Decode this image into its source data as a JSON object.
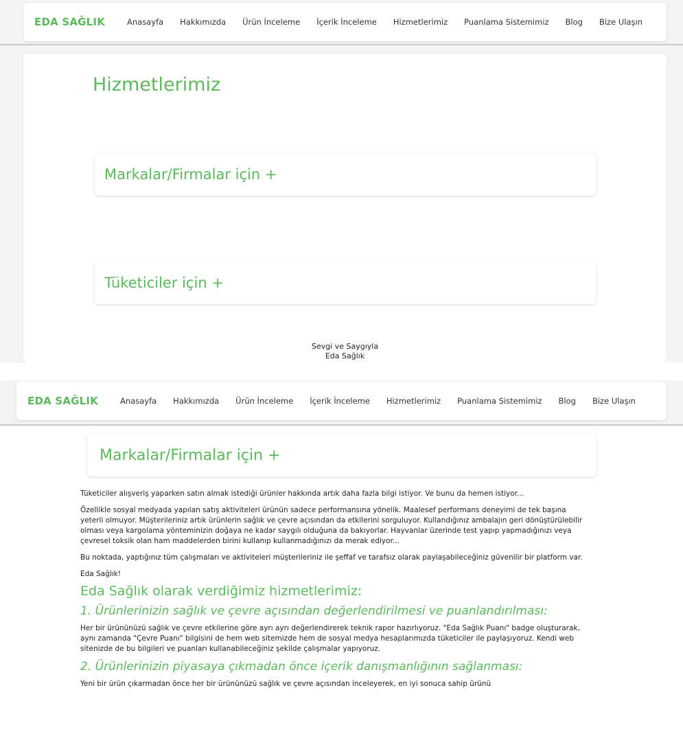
{
  "nav": {
    "brand": "EDA SAĞLIK",
    "links": [
      "Anasayfa",
      "Hakkımızda",
      "Ürün İnceleme",
      "İçerik İnceleme",
      "Hizmetlerimiz",
      "Puanlama Sistemimiz",
      "Blog",
      "Bize Ulaşın"
    ]
  },
  "top": {
    "title": "Hizmetlerimiz",
    "accordion_brands": "Markalar/Firmalar için +",
    "accordion_consumers": "Tüketiciler için +",
    "sign_line1": "Sevgi ve Saygıyla",
    "sign_line2": "Eda Sağlık"
  },
  "bottom": {
    "accordion_brands": "Markalar/Firmalar için +",
    "p1": "Tüketiciler alışveriş yaparken satın almak istediği ürünler hakkında artık daha fazla bilgi istiyor. Ve bunu da hemen istiyor...",
    "p2": "Özellikle sosyal medyada yapılan satış aktiviteleri ürünün sadece performansına yönelik. Maalesef performans deneyimi de tek başına yeterli olmuyor. Müşterileriniz artık ürünlerin sağlık ve çevre açısından da etkilerini sorguluyor. Kullandığınız ambalajın geri dönüştürülebilir olması veya kargolama yönteminizin doğaya ne kadar saygılı olduğuna da bakıyorlar. Hayvanlar üzerinde test yapıp yapmadığınızı veya çevresel toksik olan ham maddelerden birini kullanıp kullanmadığınızı da merak ediyor...",
    "p3": "Bu noktada, yaptığınız tüm çalışmaları ve aktiviteleri müşterileriniz ile şeffaf ve tarafsız olarak paylaşabileceğiniz güvenilir bir platform var.",
    "p4": "Eda Sağlık!",
    "h_services": "Eda Sağlık olarak verdiğimiz hizmetlerimiz:",
    "s1_title": "1. Ürünlerinizin sağlık ve çevre açısından değerlendirilmesi ve puanlandırılması:",
    "s1_text": "Her bir ürününüzü sağlık ve çevre etkilerine göre ayrı ayrı değerlendirerek teknik rapor hazırlıyoruz. \"Eda Sağlık Puanı\" badge oluşturarak, aynı zamanda \"Çevre Puanı\" bilgisini de hem web sitemizde hem de sosyal medya hesaplarımızda tüketiciler ile paylaşıyoruz. Kendi web sitenizde de bu bilgileri ve puanları kullanabileceğiniz şekilde çalışmalar yapıyoruz.",
    "s2_title": "2. Ürünlerinizin piyasaya çıkmadan önce içerik danışmanlığının sağlanması:",
    "s2_text": "Yeni bir ürün çıkarmadan önce her bir ürününüzü sağlık ve çevre açısından inceleyerek, en iyi sonuca sahip ürünü"
  }
}
